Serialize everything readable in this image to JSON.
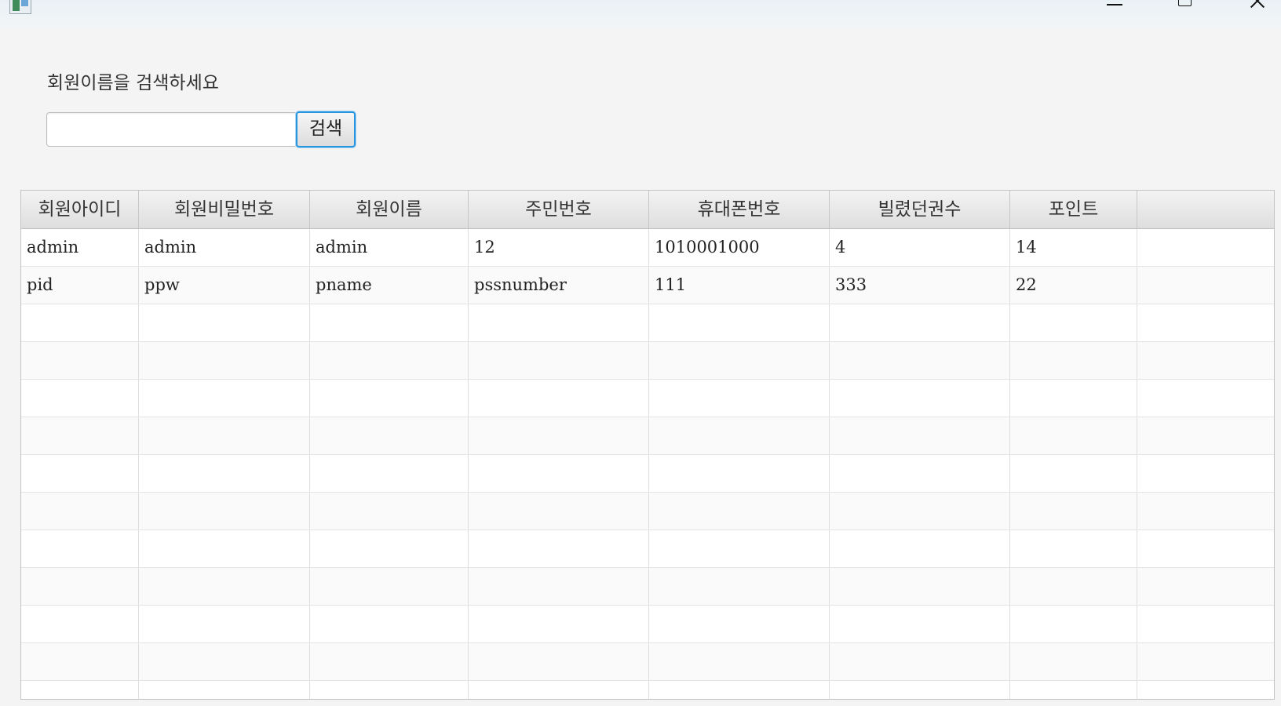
{
  "search": {
    "label": "회원이름을 검색하세요",
    "input_value": "",
    "button_label": "검색"
  },
  "table": {
    "columns": [
      "회원아이디",
      "회원비밀번호",
      "회원이름",
      "주민번호",
      "휴대폰번호",
      "빌렸던권수",
      "포인트",
      ""
    ],
    "rows": [
      [
        "admin",
        "admin",
        "admin",
        "12",
        "1010001000",
        "4",
        "14",
        ""
      ],
      [
        "pid",
        "ppw",
        "pname",
        "pssnumber",
        "111",
        "333",
        "22",
        ""
      ]
    ]
  }
}
